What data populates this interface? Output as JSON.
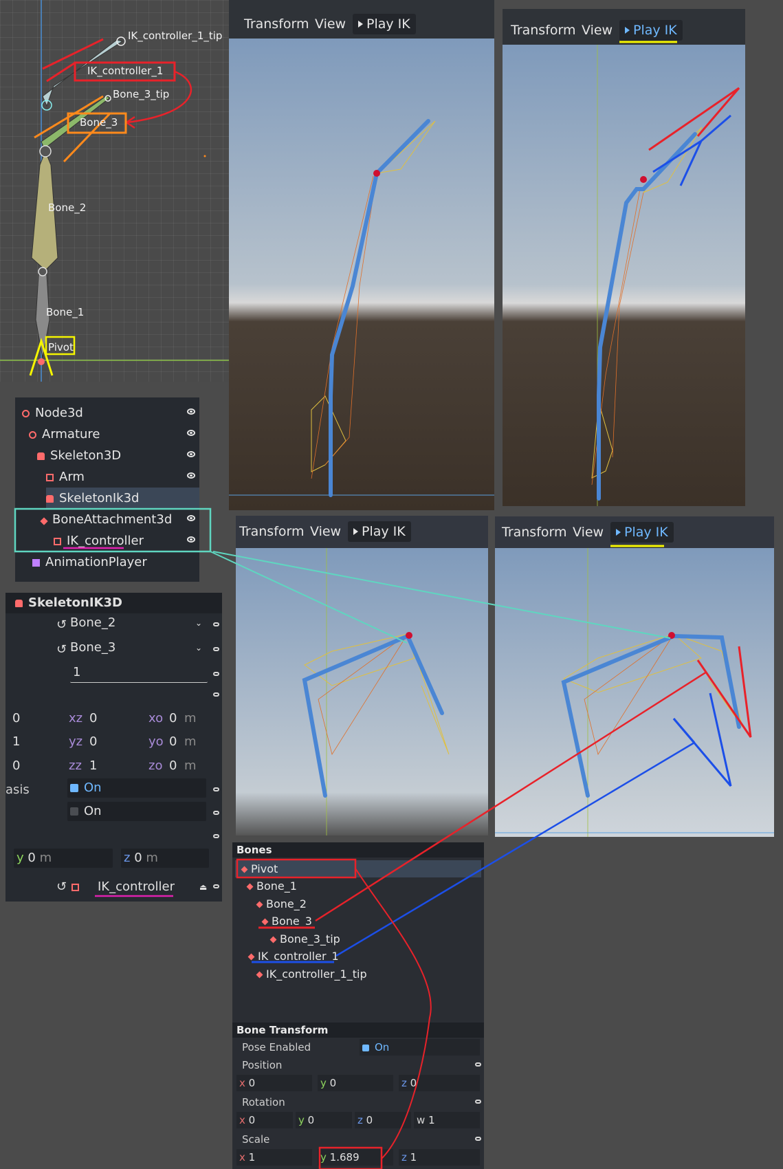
{
  "editor2d": {
    "labels": {
      "ik_tip": "IK_controller_1_tip",
      "ik_controller": "IK_controller_1",
      "bone3_tip": "Bone_3_tip",
      "bone3": "Bone_3",
      "bone2": "Bone_2",
      "bone1": "Bone_1",
      "pivot": "Pivot"
    }
  },
  "viewports": [
    {
      "transform": "Transform",
      "view": "View",
      "play": "Play IK"
    },
    {
      "transform": "Transform",
      "view": "View",
      "play": "Play IK"
    },
    {
      "transform": "Transform",
      "view": "View",
      "play": "Play IK"
    },
    {
      "transform": "Transform",
      "view": "View",
      "play": "Play IK"
    }
  ],
  "scene_tree": {
    "items": [
      "Node3d",
      "Armature",
      "Skeleton3D",
      "Arm",
      "SkeletonIk3d",
      "BoneAttachment3d",
      "IK_controller",
      "AnimationPlayer"
    ]
  },
  "inspector": {
    "title": "SkeletonIK3D",
    "root_bone": "Bone_2",
    "tip_bone": "Bone_3",
    "interpolation": "1",
    "matrix": {
      "row1": {
        "a": "0",
        "b_label": "xz",
        "b": "0",
        "c_label": "xo",
        "c": "0",
        "unit": "m"
      },
      "row2": {
        "a": "1",
        "b_label": "yz",
        "b": "0",
        "c_label": "yo",
        "c": "0",
        "unit": "m"
      },
      "row3": {
        "a": "0",
        "b_label": "zz",
        "b": "1",
        "c_label": "zo",
        "c": "0",
        "unit": "m"
      }
    },
    "basis_label": "asis",
    "override_on": "On",
    "second_on": "On",
    "magnet": {
      "y_label": "y",
      "y": "0",
      "z_label": "z",
      "z": "0",
      "unit": "m"
    },
    "target_node": "IK_controller"
  },
  "bones_panel": {
    "section": "Bones",
    "items": [
      "Pivot",
      "Bone_1",
      "Bone_2",
      "Bone_3",
      "Bone_3_tip",
      "IK_controller_1",
      "IK_controller_1_tip"
    ],
    "bone_transform": "Bone Transform",
    "pose_enabled_label": "Pose Enabled",
    "pose_enabled_value": "On",
    "position_label": "Position",
    "position": {
      "x": "0",
      "y": "0",
      "z": "0"
    },
    "rotation_label": "Rotation",
    "rotation": {
      "x": "0",
      "y": "0",
      "z": "0",
      "w": "1"
    },
    "scale_label": "Scale",
    "scale": {
      "x": "1",
      "y": "1.689",
      "z": "1"
    }
  },
  "colors": {
    "annotation_red": "#e8222a",
    "annotation_blue": "#1c4fe8",
    "annotation_teal": "#5fd6c0",
    "annotation_yellow": "#f5f500",
    "annotation_orange": "#ff8a1c",
    "annotation_magenta": "#e020b0",
    "accent": "#6fb8ff"
  }
}
